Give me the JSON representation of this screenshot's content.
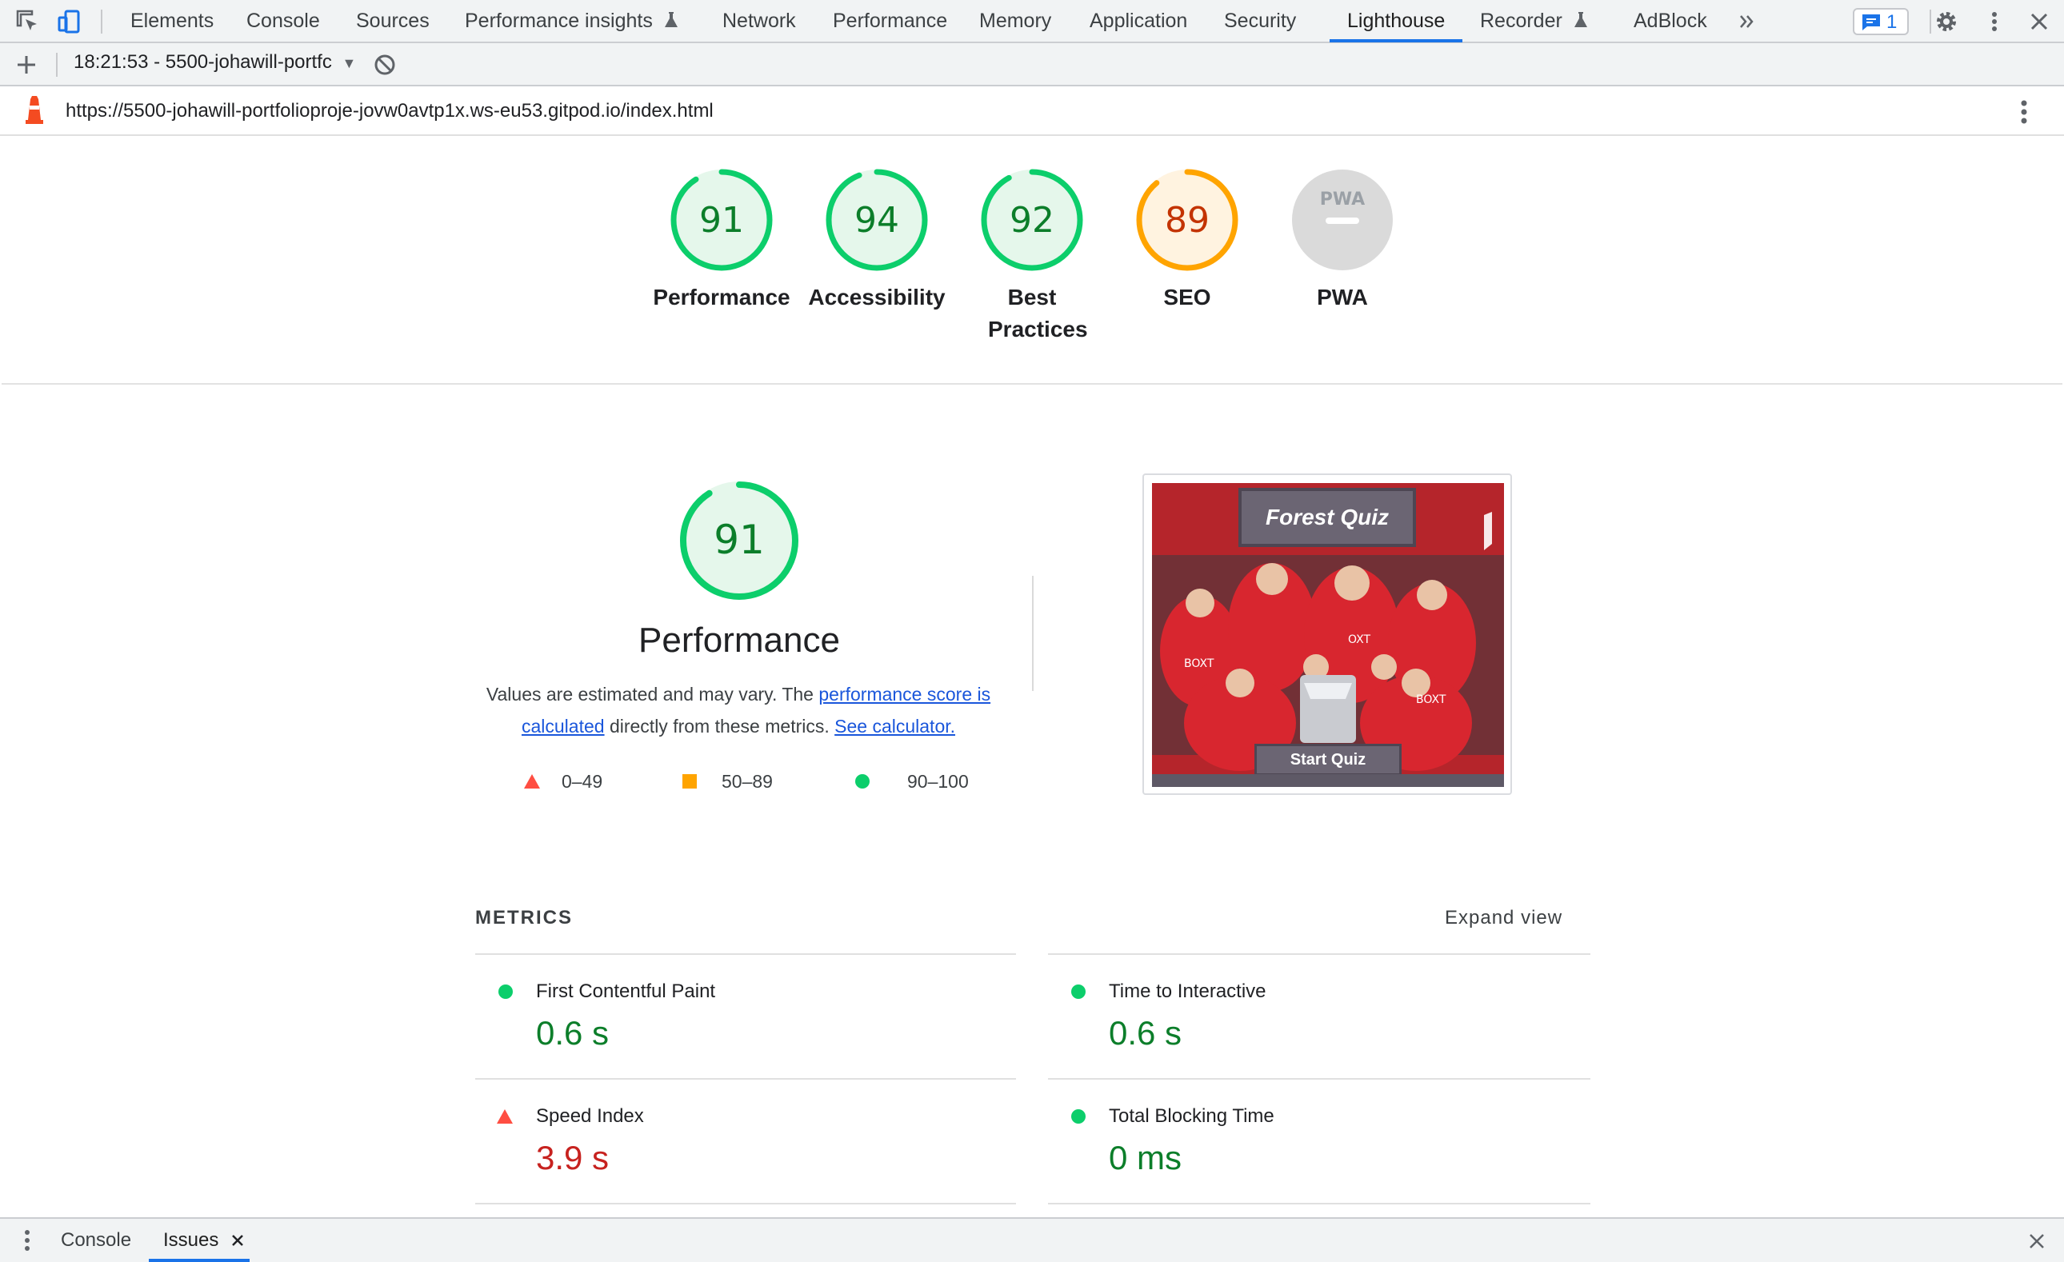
{
  "devtools": {
    "tabs": [
      "Elements",
      "Console",
      "Sources",
      "Performance insights",
      "Network",
      "Performance",
      "Memory",
      "Application",
      "Security",
      "Lighthouse",
      "Recorder",
      "AdBlock"
    ],
    "active_tab": "Lighthouse",
    "issues_count": "1"
  },
  "report_bar": {
    "report_label": "18:21:53 - 5500-johawill-portfc"
  },
  "url_bar": {
    "url": "https://5500-johawill-portfolioproje-jovw0avtp1x.ws-eu53.gitpod.io/index.html"
  },
  "gauges": [
    {
      "score": "91",
      "label": "Performance",
      "status": "pass",
      "fraction": 0.91
    },
    {
      "score": "94",
      "label": "Accessibility",
      "status": "pass",
      "fraction": 0.94
    },
    {
      "score": "92",
      "label": "Best Practices",
      "status": "pass",
      "fraction": 0.92
    },
    {
      "score": "89",
      "label": "SEO",
      "status": "average",
      "fraction": 0.89
    },
    {
      "score": "PWA",
      "label": "PWA",
      "status": "na",
      "fraction": 0
    }
  ],
  "performance": {
    "score": "91",
    "fraction": 0.91,
    "title": "Performance",
    "desc_before": "Values are estimated and may vary. The ",
    "desc_link1": "performance score is calculated",
    "desc_middle": " directly from these metrics. ",
    "desc_link2": "See calculator.",
    "legend": {
      "fail": "0–49",
      "average": "50–89",
      "pass": "90–100"
    }
  },
  "screenshot": {
    "title": "Forest Quiz",
    "button": "Start Quiz"
  },
  "metrics": {
    "heading": "METRICS",
    "expand": "Expand view",
    "items": [
      {
        "name": "First Contentful Paint",
        "value": "0.6 s",
        "status": "pass"
      },
      {
        "name": "Time to Interactive",
        "value": "0.6 s",
        "status": "pass"
      },
      {
        "name": "Speed Index",
        "value": "3.9 s",
        "status": "fail"
      },
      {
        "name": "Total Blocking Time",
        "value": "0 ms",
        "status": "pass"
      }
    ]
  },
  "drawer": {
    "tabs": [
      "Console",
      "Issues"
    ],
    "active_tab": "Issues"
  },
  "colors": {
    "pass": "#0c7e2a",
    "pass_ring": "#0cce6b",
    "average": "#c33300",
    "average_ring": "#ffa400",
    "fail": "#c7221f",
    "fail_icon": "#ff4e42",
    "accent": "#1a73e8"
  }
}
